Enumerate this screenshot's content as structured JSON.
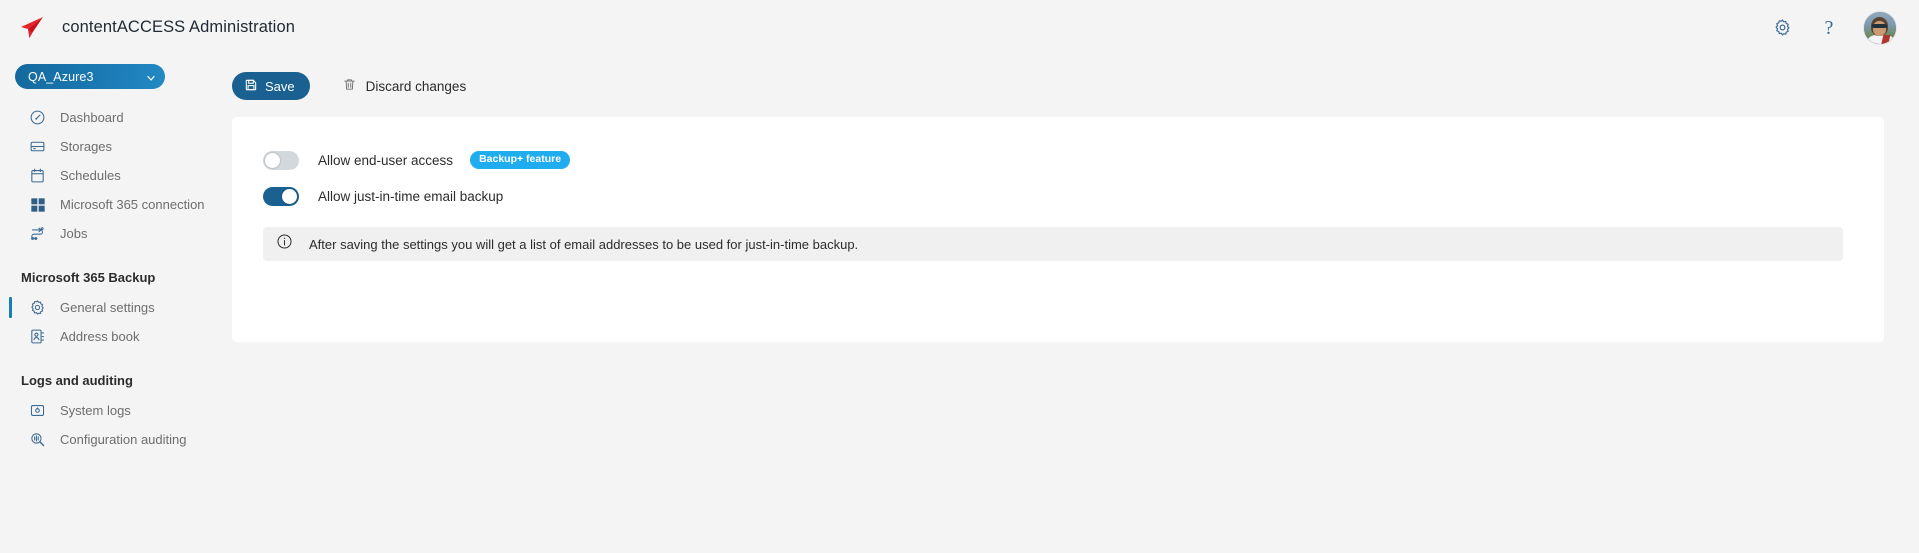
{
  "header": {
    "logo_icon": "paper-plane-logo",
    "title": "contentACCESS Administration",
    "settings_icon": "gear-icon",
    "help_icon": "question-mark-icon",
    "help_glyph": "?",
    "avatar_icon": "user-avatar",
    "accent_color": "#e8232a"
  },
  "sidebar": {
    "tenant": {
      "label": "QA_Azure3",
      "chevron_icon": "chevron-down-icon"
    },
    "items": [
      {
        "label": "Dashboard",
        "icon": "dashboard-gauge-icon",
        "active": false
      },
      {
        "label": "Storages",
        "icon": "storage-drive-icon",
        "active": false
      },
      {
        "label": "Schedules",
        "icon": "calendar-icon",
        "active": false
      },
      {
        "label": "Microsoft 365 connection",
        "icon": "microsoft-grid-icon",
        "active": false
      },
      {
        "label": "Jobs",
        "icon": "jobs-flow-icon",
        "active": false
      }
    ],
    "groups": [
      {
        "title": "Microsoft 365 Backup",
        "items": [
          {
            "label": "General settings",
            "icon": "gear-icon",
            "active": true
          },
          {
            "label": "Address book",
            "icon": "address-book-icon",
            "active": false
          }
        ]
      },
      {
        "title": "Logs and auditing",
        "items": [
          {
            "label": "System logs",
            "icon": "system-logs-icon",
            "active": false
          },
          {
            "label": "Configuration auditing",
            "icon": "audit-search-icon",
            "active": false
          }
        ]
      }
    ],
    "active_indicator_color": "#1b7db8"
  },
  "toolbar": {
    "save_label": "Save",
    "save_icon": "floppy-disk-icon",
    "save_color": "#1a6191",
    "discard_label": "Discard changes",
    "discard_icon": "trash-icon"
  },
  "settings": {
    "rows": [
      {
        "label": "Allow end-user access",
        "enabled": false,
        "badge": "Backup+ feature",
        "badge_color": "#1fadef"
      },
      {
        "label": "Allow just-in-time email backup",
        "enabled": true,
        "badge": null,
        "badge_color": null
      }
    ],
    "info": {
      "icon": "info-circle-icon",
      "text": "After saving the settings you will get a list of email addresses to be used for just-in-time backup."
    }
  }
}
